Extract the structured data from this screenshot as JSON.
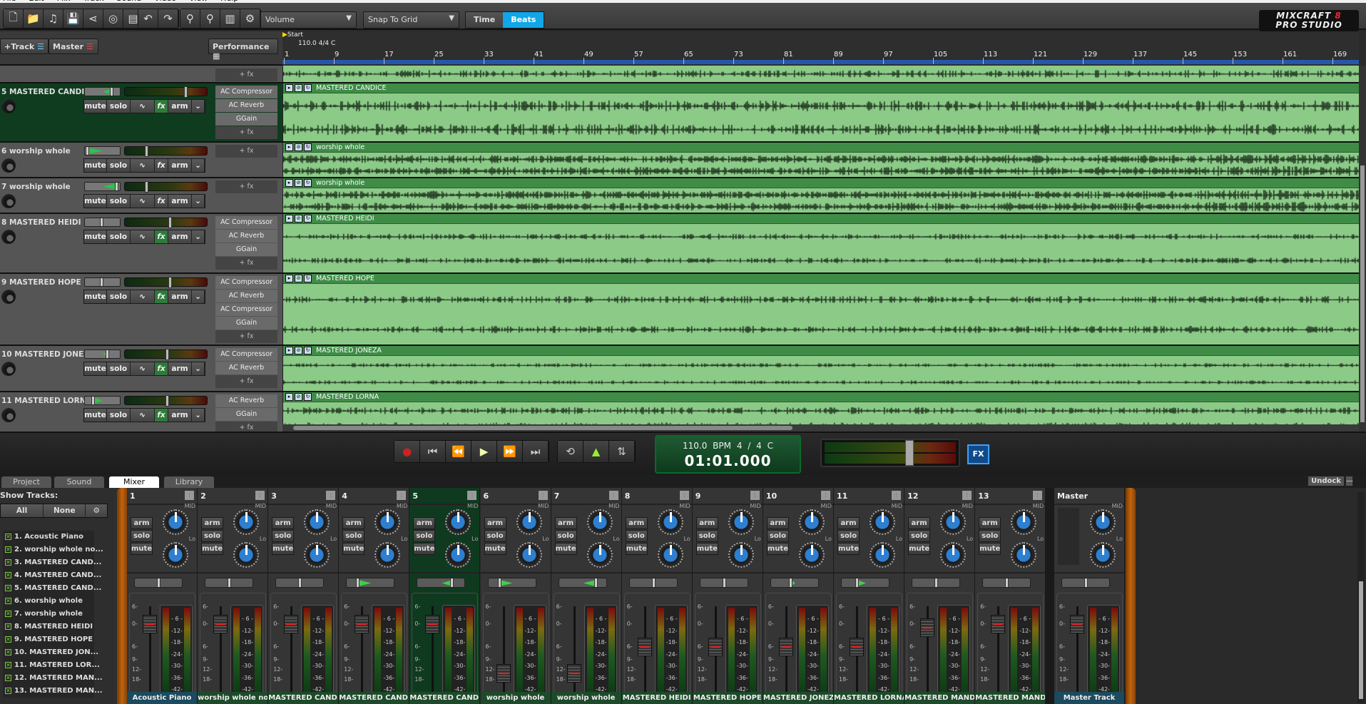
{
  "menu": [
    "File",
    "Edit",
    "Mix",
    "Track",
    "Sound",
    "Video",
    "View",
    "Help"
  ],
  "toolbar": {
    "icons": [
      "new-file-icon",
      "open-folder-icon",
      "open-music-icon",
      "save-icon",
      "share-icon",
      "burn-cd-icon",
      "mixdown-icon",
      "undo-icon",
      "redo-icon",
      "zoom-in-icon",
      "zoom-out-icon",
      "midi-icon",
      "settings-gear-icon"
    ],
    "volume_dropdown": "Volume",
    "snap_dropdown": "Snap To Grid",
    "time_label": "Time",
    "beats_label": "Beats",
    "active_mode": "Beats",
    "accent": "#10a6e8"
  },
  "logo": {
    "line1": "MIXCRAFT",
    "version": "8",
    "line2": "PRO STUDIO"
  },
  "header": {
    "add_track": "+Track",
    "master": "Master",
    "performance": "Performance"
  },
  "ruler": {
    "start_marker": "Start",
    "tempo_info": "110.0 4/4 C",
    "bars": [
      1,
      9,
      17,
      25,
      33,
      41,
      49,
      57,
      65,
      73,
      81,
      89,
      97,
      105,
      113,
      121,
      129,
      137,
      145,
      153,
      161,
      169
    ]
  },
  "tracks": [
    {
      "label": "",
      "fx": [],
      "add_fx": "+ fx",
      "clip": "",
      "partial": true
    },
    {
      "label": "5 MASTERED CANDICE",
      "fx": [
        "AC Compressor",
        "AC Reverb",
        "GGain"
      ],
      "add_fx": "+ fx",
      "clip": "MASTERED CANDICE",
      "selected": true,
      "fx_on": true,
      "pan": 0.55,
      "volume": 0.75
    },
    {
      "label": "6 worship whole",
      "fx": [],
      "add_fx": "+ fx",
      "clip": "worship whole",
      "fx_on": false,
      "pan": -0.9,
      "volume": 0.25
    },
    {
      "label": "7 worship whole",
      "fx": [],
      "add_fx": "+ fx",
      "clip": "worship whole",
      "fx_on": false,
      "pan": 0.85,
      "volume": 0.25
    },
    {
      "label": "8 MASTERED HEIDI",
      "fx": [
        "AC Compressor",
        "AC Reverb",
        "GGain"
      ],
      "add_fx": "+ fx",
      "clip": "MASTERED HEIDI",
      "fx_on": true,
      "pan": -0.05,
      "volume": 0.55
    },
    {
      "label": "9 MASTERED HOPE",
      "fx": [
        "AC Compressor",
        "AC Reverb",
        "AC Compressor",
        "GGain"
      ],
      "add_fx": "+ fx",
      "clip": "MASTERED HOPE",
      "fx_on": true,
      "pan": -0.05,
      "volume": 0.55
    },
    {
      "label": "10 MASTERED JONEZA",
      "fx": [
        "AC Compressor",
        "AC Reverb"
      ],
      "add_fx": "+ fx",
      "clip": "MASTERED JONEZA",
      "fx_on": true,
      "pan": 0.3,
      "volume": 0.52
    },
    {
      "label": "11 MASTERED LORNA",
      "fx": [
        "AC Reverb",
        "GGain"
      ],
      "add_fx": "+ fx",
      "clip": "MASTERED LORNA",
      "fx_on": true,
      "pan": -0.55,
      "volume": 0.52
    }
  ],
  "track_buttons": {
    "mute": "mute",
    "solo": "solo",
    "fx": "fx",
    "arm": "arm"
  },
  "transport": {
    "bpm": "110.0 BPM",
    "signature": "4 / 4",
    "key": "C",
    "time": "01:01.000",
    "fx": "FX",
    "master_volume": 0.63
  },
  "tabs": [
    {
      "label": "Project"
    },
    {
      "label": "Sound"
    },
    {
      "label": "Mixer",
      "active": true
    },
    {
      "label": "Library"
    }
  ],
  "undock": "Undock",
  "undock_minimize": "—",
  "show_tracks": {
    "title": "Show Tracks:",
    "all": "All",
    "none": "None",
    "items": [
      "1. Acoustic Piano",
      "2. worship whole no...",
      "3. MASTERED CAND...",
      "4. MASTERED CAND...",
      "5. MASTERED CAND...",
      "6. worship whole",
      "7. worship whole",
      "8. MASTERED HEIDI",
      "9. MASTERED HOPE",
      "10. MASTERED JON...",
      "11. MASTERED LOR...",
      "12. MASTERED MAN...",
      "13. MASTERED MAN..."
    ]
  },
  "mixer": {
    "arm": "arm",
    "solo": "solo",
    "mute": "mute",
    "knob_mid": "MID",
    "knob_lo": "Lo",
    "fader_scale": [
      "6-",
      "0-",
      "6-",
      "9-",
      "12-",
      "18-",
      "oo-"
    ],
    "meter_scale": [
      "- 6 -",
      "-12-",
      "-18-",
      "-24-",
      "-30-",
      "-36-",
      "-42-"
    ],
    "channels": [
      {
        "num": "1",
        "name": "Acoustic Piano",
        "pan": 0,
        "fader_db": 0,
        "blue": true
      },
      {
        "num": "2",
        "name": "worship whole no...",
        "pan": 0,
        "fader_db": 0
      },
      {
        "num": "3",
        "name": "MASTERED CAND...",
        "pan": 0,
        "fader_db": 0
      },
      {
        "num": "4",
        "name": "MASTERED CAND...",
        "pan": -0.6,
        "fader_db": 0
      },
      {
        "num": "5",
        "name": "MASTERED CAND...",
        "pan": 0.5,
        "fader_db": 0,
        "selected": true
      },
      {
        "num": "6",
        "name": "worship whole",
        "pan": -0.6,
        "fader_db": -14
      },
      {
        "num": "7",
        "name": "worship whole",
        "pan": 0.6,
        "fader_db": -14
      },
      {
        "num": "8",
        "name": "MASTERED HEIDI",
        "pan": 0,
        "fader_db": -6
      },
      {
        "num": "9",
        "name": "MASTERED HOPE",
        "pan": 0,
        "fader_db": -6
      },
      {
        "num": "10",
        "name": "MASTERED JONEZA",
        "pan": -0.2,
        "fader_db": -6
      },
      {
        "num": "11",
        "name": "MASTERED LORNA",
        "pan": -0.4,
        "fader_db": -6
      },
      {
        "num": "12",
        "name": "MASTERED MAND...",
        "pan": 0,
        "fader_db": -1
      },
      {
        "num": "13",
        "name": "MASTERED MAND...",
        "pan": 0,
        "fader_db": 0
      }
    ],
    "master": {
      "title": "Master",
      "name": "Master Track",
      "pan": 0,
      "fader_db": 0
    }
  }
}
